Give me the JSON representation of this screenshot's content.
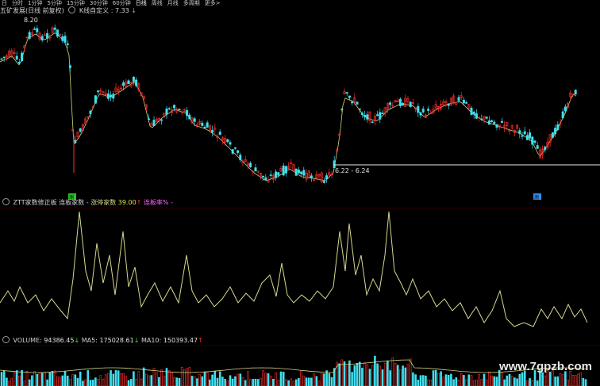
{
  "toolbar": {
    "items": [
      "日",
      "分时",
      "1分钟",
      "5分钟",
      "15分钟",
      "30分钟",
      "60分钟",
      "日线",
      "周线",
      "月线",
      "多周期",
      "更多>"
    ],
    "active_index": 7
  },
  "kline_header": {
    "stock": "五矿发展(日线 前复权)",
    "indicator": "K线自定义",
    "value": "7.33",
    "value_arrow": "↓"
  },
  "price_labels": {
    "high": "8.20",
    "range": "6.22 - 6.24"
  },
  "markers": {
    "left": "测",
    "right": "测"
  },
  "indicator_header": {
    "name": "ZTT家数修正板",
    "f1": "连板家数",
    "dash1": "-",
    "f2": "涨停家数",
    "v2": "39.00",
    "v2_arrow": "↑",
    "f3": "连板率%",
    "dash3": "-"
  },
  "volume_header": {
    "name": "VOLUME",
    "v": "94386.45",
    "v_arrow": "↓",
    "ma5_label": "MA5",
    "ma5": "175028.61",
    "ma5_arrow": "↓",
    "ma10_label": "MA10",
    "ma10": "150393.47",
    "ma10_arrow": "↑"
  },
  "watermark": "www.7gpzb.com",
  "colors": {
    "up": "#ff3030",
    "down": "#40e0f0",
    "ma": "#d4d47a",
    "indicator_line": "#d8d890",
    "magenta": "#ff60ff",
    "yellow": "#e8e040",
    "green_marker": "#30c030",
    "blue_marker": "#3090ff"
  }
}
